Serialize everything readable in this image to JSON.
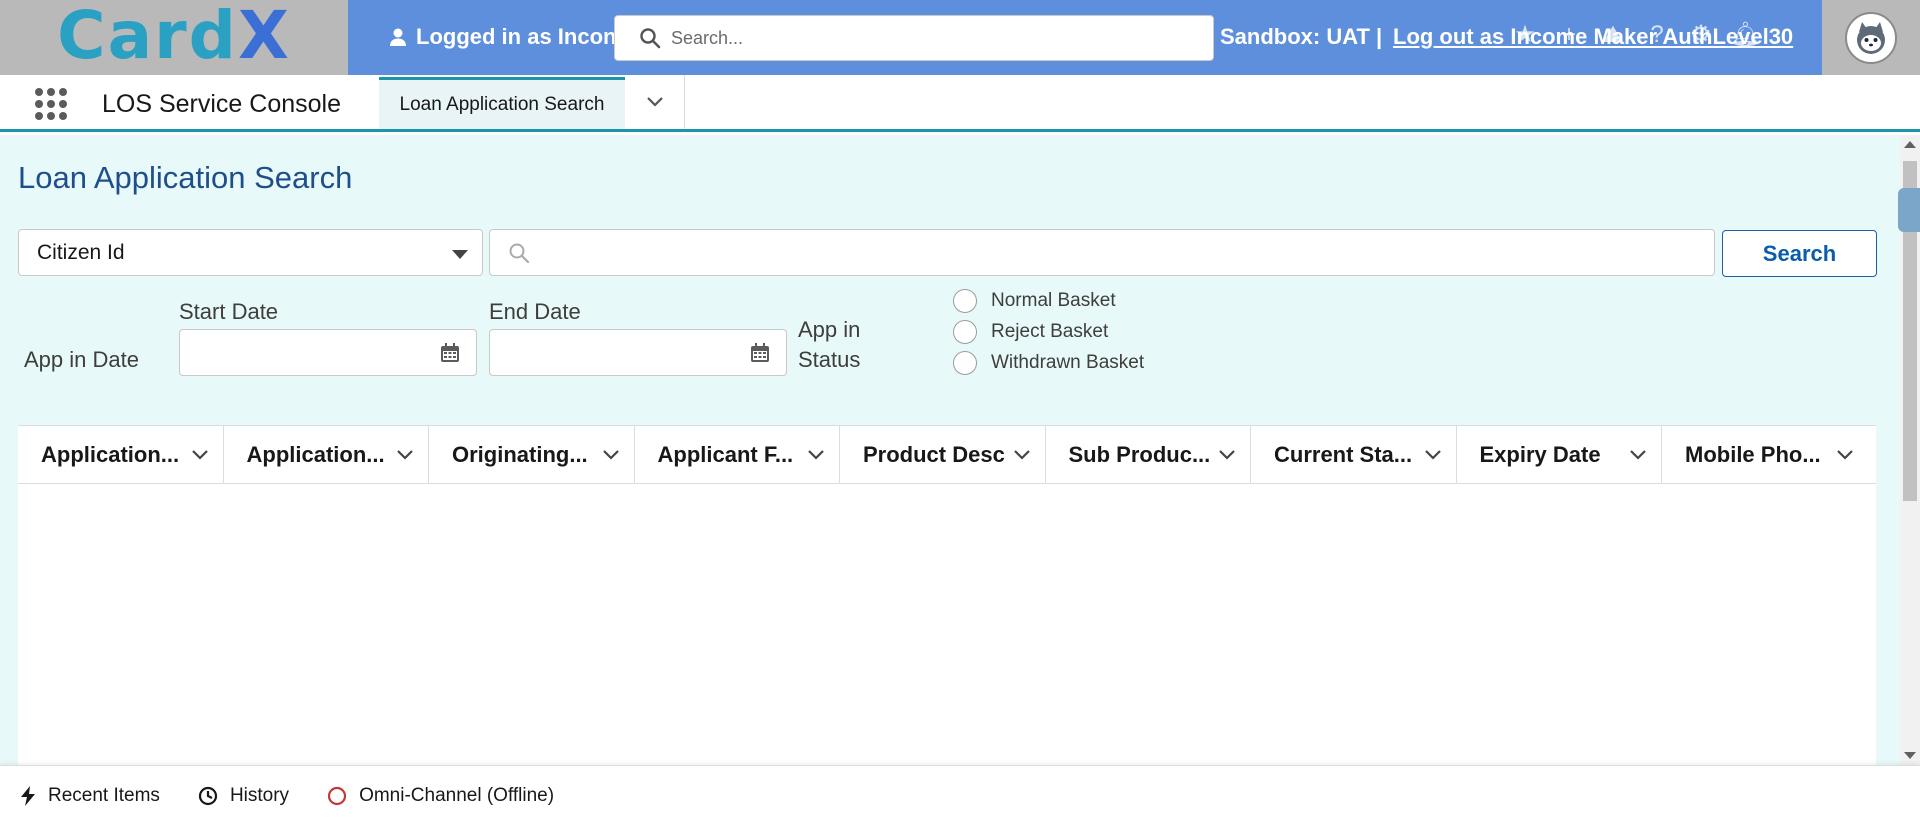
{
  "header": {
    "logo_text_1": "Card",
    "logo_text_2": "X",
    "logged_in_text": "Logged in as Incon",
    "search_placeholder": "Search...",
    "sandbox_text": "Sandbox: UAT |",
    "logout_text": "Log out as Income Maker AuthLevel30"
  },
  "nav": {
    "app_name": "LOS Service Console",
    "tab_label": "Loan Application Search"
  },
  "main": {
    "title": "Loan Application Search",
    "search_type_value": "Citizen Id",
    "query_value": "",
    "search_button": "Search",
    "app_in_date_label": "App in Date",
    "start_date_label": "Start Date",
    "end_date_label": "End Date",
    "app_in_status_label_1": "App in",
    "app_in_status_label_2": "Status",
    "radios": [
      "Normal Basket",
      "Reject Basket",
      "Withdrawn Basket"
    ],
    "columns": [
      "Application...",
      "Application...",
      "Originating...",
      "Applicant F...",
      "Product Desc",
      "Sub Produc...",
      "Current Sta...",
      "Expiry Date",
      "Mobile Pho..."
    ]
  },
  "footer": {
    "recent_items": "Recent Items",
    "history": "History",
    "omni_channel": "Omni-Channel (Offline)"
  },
  "colors": {
    "header_bg": "#5e8fdd",
    "main_bg": "#e7f9f8",
    "accent": "#1b96a9",
    "title": "#1f4e8c",
    "offline_red": "#c23934"
  }
}
